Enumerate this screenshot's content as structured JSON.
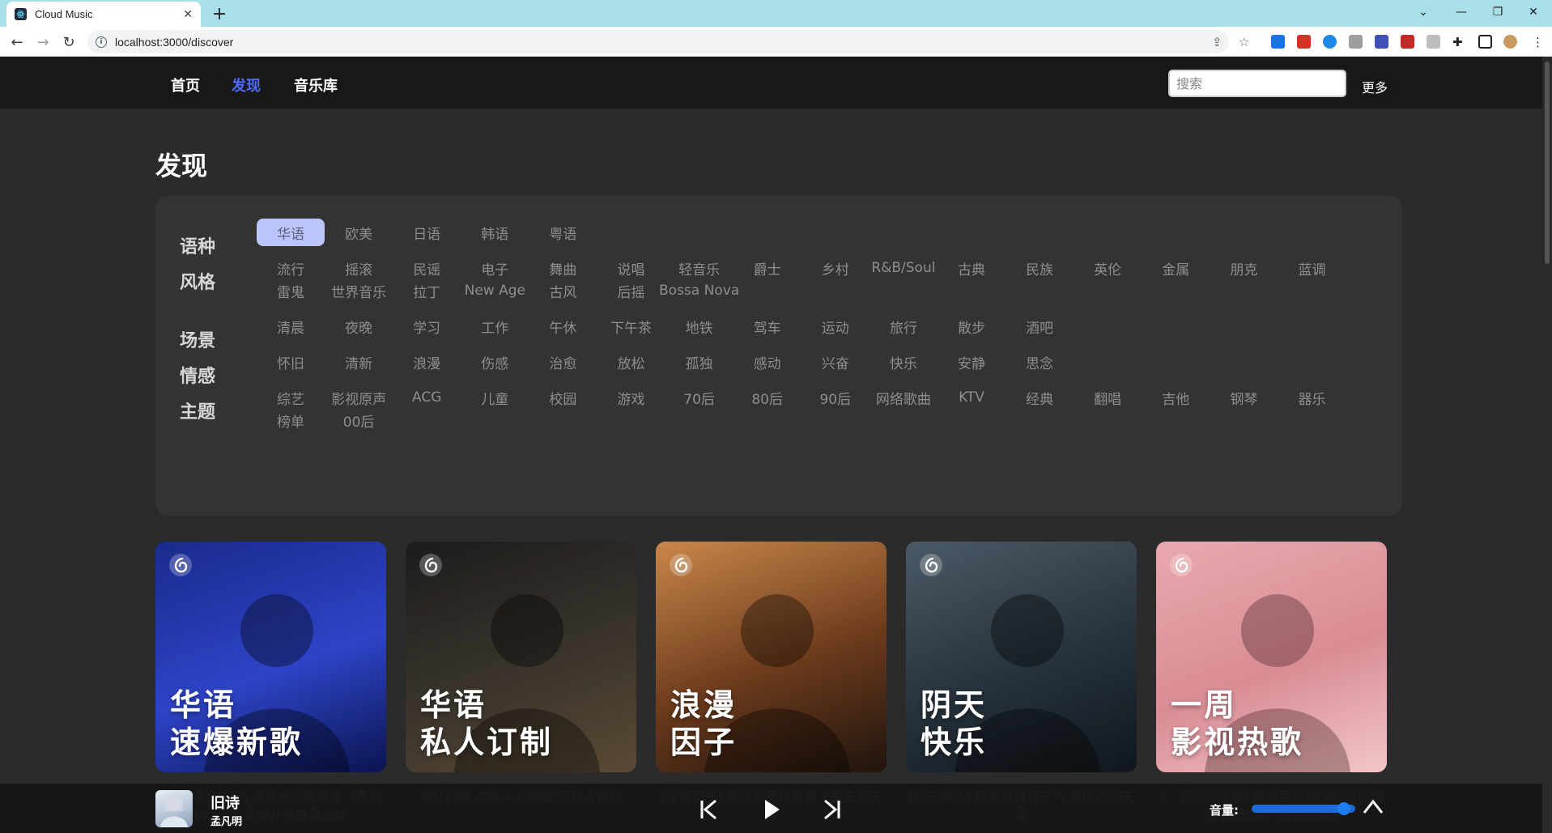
{
  "browser": {
    "tab_title": "Cloud Music",
    "url": "localhost:3000/discover"
  },
  "header": {
    "nav": [
      {
        "label": "首页"
      },
      {
        "label": "发现"
      },
      {
        "label": "音乐库"
      }
    ],
    "active_index": 1,
    "search_placeholder": "搜索",
    "more_label": "更多"
  },
  "page_title": "发现",
  "filters": {
    "language": {
      "label": "语种",
      "items": [
        "华语",
        "欧美",
        "日语",
        "韩语",
        "粤语"
      ],
      "active": "华语"
    },
    "style": {
      "label": "风格",
      "items": [
        "流行",
        "摇滚",
        "民谣",
        "电子",
        "舞曲",
        "说唱",
        "轻音乐",
        "爵士",
        "乡村",
        "R&B/Soul",
        "古典",
        "民族",
        "英伦",
        "金属",
        "朋克",
        "蓝调",
        "雷鬼",
        "世界音乐",
        "拉丁",
        "New Age",
        "古风",
        "后摇",
        "Bossa Nova"
      ]
    },
    "scene": {
      "label": "场景",
      "items": [
        "清晨",
        "夜晚",
        "学习",
        "工作",
        "午休",
        "下午茶",
        "地铁",
        "驾车",
        "运动",
        "旅行",
        "散步",
        "酒吧"
      ]
    },
    "emotion": {
      "label": "情感",
      "items": [
        "怀旧",
        "清新",
        "浪漫",
        "伤感",
        "治愈",
        "放松",
        "孤独",
        "感动",
        "兴奋",
        "快乐",
        "安静",
        "思念"
      ]
    },
    "theme": {
      "label": "主题",
      "items": [
        "综艺",
        "影视原声",
        "ACG",
        "儿童",
        "校园",
        "游戏",
        "70后",
        "80后",
        "90后",
        "网络歌曲",
        "KTV",
        "经典",
        "翻唱",
        "吉他",
        "钢琴",
        "器乐",
        "榜单",
        "00后"
      ]
    }
  },
  "playlists": [
    {
      "line1": "华语",
      "line2": "速爆新歌",
      "desc": "[华语速爆新歌] 袁娅维深情演绎《靠近 live版》爱盛开在春夏之交",
      "colors": [
        "#1a2a8c",
        "#2d44c7",
        "#0b1450"
      ]
    },
    {
      "line1": "华语",
      "line2": "私人订制",
      "desc": "阿杜的歌,总令人心动|华语私人雷达",
      "colors": [
        "#1c1c1c",
        "#3a342c",
        "#5a4a34"
      ]
    },
    {
      "line1": "浪漫",
      "line2": "因子",
      "desc": "[浪漫因子] 可以邀请你和我一起去春天吗",
      "colors": [
        "#c9874a",
        "#6b3a1c",
        "#1f140e"
      ]
    },
    {
      "line1": "阴天",
      "line2": "快乐",
      "desc": "[阴天快乐] 如果情绪有天气 我陷在阴天里",
      "colors": [
        "#4a5a66",
        "#26323c",
        "#10161c"
      ]
    },
    {
      "line1": "一周",
      "line2": "影视热歌",
      "desc": "[一周影视热歌] 刘惜君轻轻吟唱电视剧《月升沧海》同名片尾曲",
      "colors": [
        "#e8a9ae",
        "#d98c94",
        "#f2c6c9"
      ]
    }
  ],
  "player": {
    "song": "旧诗",
    "artist": "孟凡明",
    "volume_label": "音量:",
    "volume": 0.75
  }
}
